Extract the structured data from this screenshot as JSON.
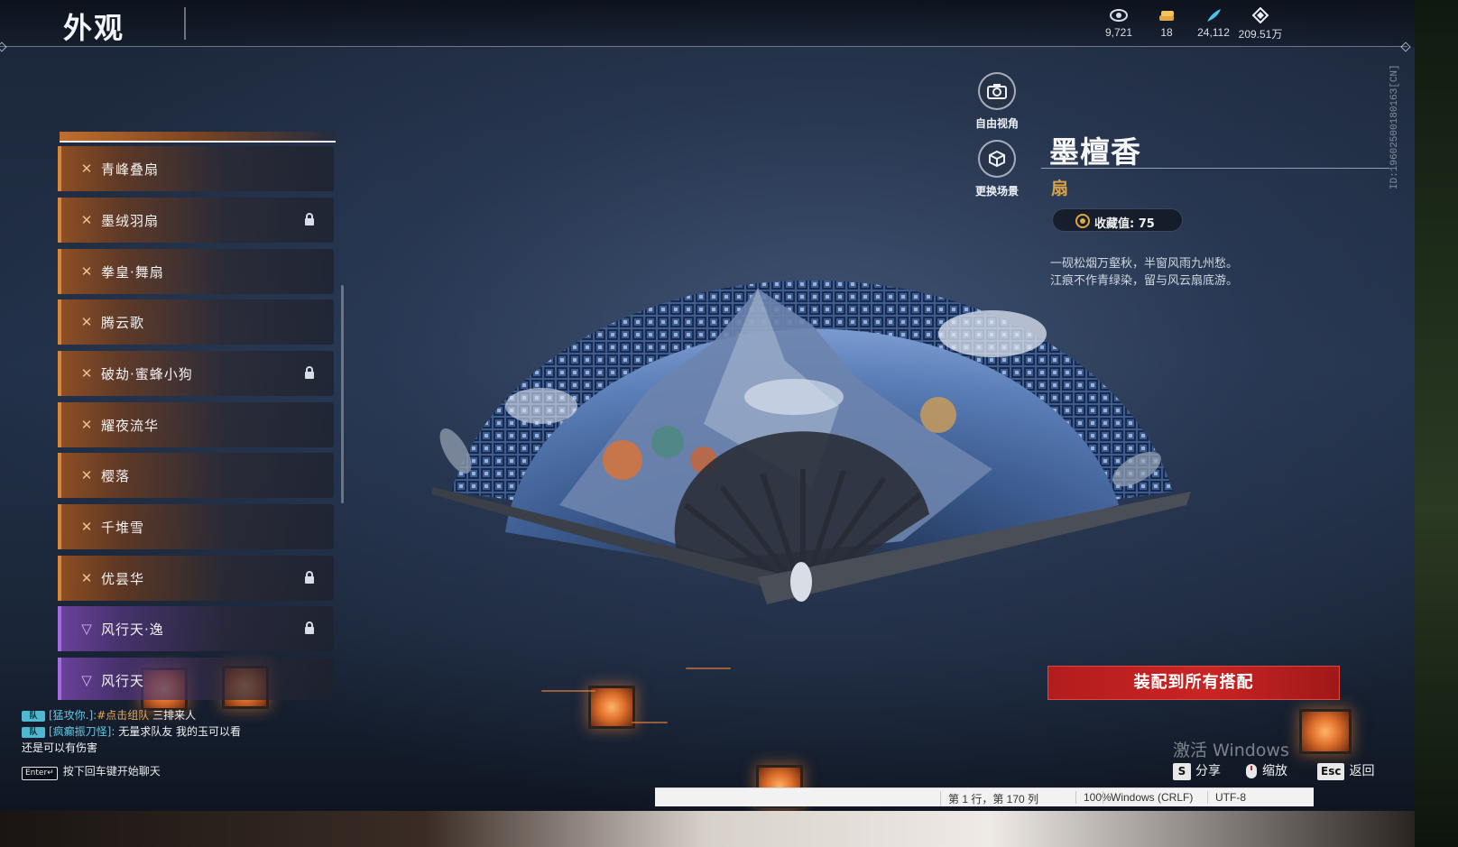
{
  "page": {
    "title": "外观"
  },
  "currencies": [
    {
      "icon": "eye-currency-icon",
      "value": "9,721"
    },
    {
      "icon": "coin-stack-icon",
      "value": "18"
    },
    {
      "icon": "feather-currency-icon",
      "value": "24,112"
    },
    {
      "icon": "diamond-currency-icon",
      "value": "209.51万"
    }
  ],
  "list": {
    "items": [
      {
        "label": "青峰叠扇",
        "locked": false,
        "rarity": "orange"
      },
      {
        "label": "墨绒羽扇",
        "locked": true,
        "rarity": "orange"
      },
      {
        "label": "拳皇·舞扇",
        "locked": false,
        "rarity": "orange"
      },
      {
        "label": "腾云歌",
        "locked": false,
        "rarity": "orange"
      },
      {
        "label": "破劫·蜜蜂小狗",
        "locked": true,
        "rarity": "orange"
      },
      {
        "label": "耀夜流华",
        "locked": false,
        "rarity": "orange"
      },
      {
        "label": "樱落",
        "locked": false,
        "rarity": "orange"
      },
      {
        "label": "千堆雪",
        "locked": false,
        "rarity": "orange"
      },
      {
        "label": "优昙华",
        "locked": true,
        "rarity": "orange"
      },
      {
        "label": "风行天·逸",
        "locked": true,
        "rarity": "purple"
      },
      {
        "label": "风行天",
        "locked": false,
        "rarity": "purple"
      }
    ]
  },
  "camera": {
    "free_view": "自由视角",
    "change_scene": "更换场景"
  },
  "item": {
    "name": "墨檀香",
    "type": "扇",
    "collect_label": "收藏值: 75",
    "description": [
      "一砚松烟万壑秋，半窗风雨九州愁。",
      "江痕不作青绿染，留与风云扇底游。"
    ],
    "id_text": "ID:1960250018016З[CN]"
  },
  "equip_button": "装配到所有搭配",
  "chat": {
    "lines": [
      {
        "badge": "队",
        "name": "[猛攻你.]:",
        "link": "#点击组队",
        "msg": " 三排来人"
      },
      {
        "badge": "队",
        "name": "[疯癫振刀怪]:",
        "link": "",
        "msg": " 无量求队友 我的玉可以看"
      },
      {
        "badge": "",
        "name": "",
        "link": "",
        "msg": "还是可以有伤害"
      }
    ],
    "hint_key": "Enter↵",
    "hint_text": "按下回车键开始聊天"
  },
  "keys": {
    "share_key": "S",
    "share_label": "分享",
    "zoom_label": "缩放",
    "back_key": "Esc",
    "back_label": "返回"
  },
  "watermark": "激活 Windows",
  "statusbar": {
    "position": "第 1 行，第 170 列",
    "zoom": "100%",
    "line_ending": "Windows (CRLF)",
    "encoding": "UTF-8"
  },
  "colors": {
    "accent_orange": "#d98838",
    "accent_purple": "#a36ce0",
    "equip_red": "#c92424",
    "type_gold": "#d8a24a"
  }
}
